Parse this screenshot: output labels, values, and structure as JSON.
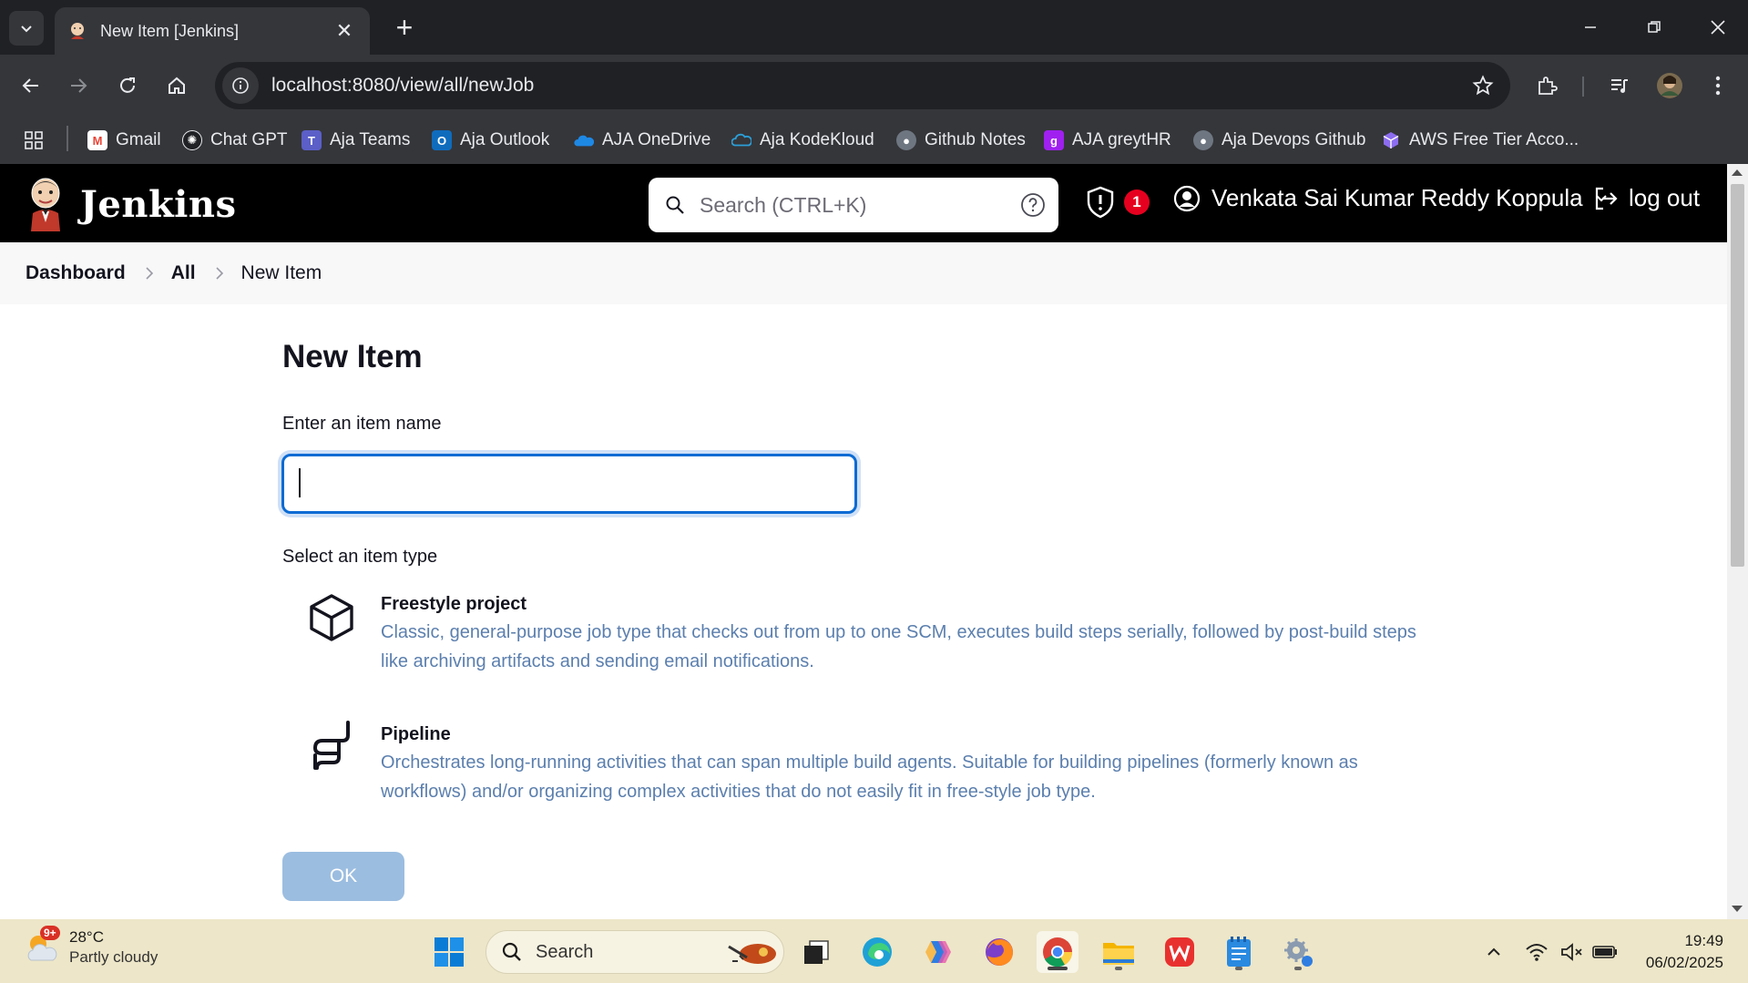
{
  "browser": {
    "tab_title": "New Item [Jenkins]",
    "url": "localhost:8080/view/all/newJob",
    "bookmarks": [
      {
        "label": "Gmail",
        "icon": "gmail-icon",
        "color": "#ea4335"
      },
      {
        "label": "Chat GPT",
        "icon": "chatgpt-icon",
        "color": "#202124"
      },
      {
        "label": "Aja Teams",
        "icon": "teams-icon",
        "color": "#5b5fc7"
      },
      {
        "label": "Aja Outlook",
        "icon": "outlook-icon",
        "color": "#0f6cbd"
      },
      {
        "label": "AJA OneDrive",
        "icon": "onedrive-icon",
        "color": "#1e88e5"
      },
      {
        "label": "Aja KodeKloud",
        "icon": "kodekloud-icon",
        "color": "#2b9fd8"
      },
      {
        "label": "Github Notes",
        "icon": "github-icon",
        "color": "#6e7681"
      },
      {
        "label": "AJA greytHR",
        "icon": "greythr-icon",
        "color": "#a020f0"
      },
      {
        "label": "Aja Devops Github",
        "icon": "github-icon",
        "color": "#6e7681"
      },
      {
        "label": "AWS Free Tier Acco...",
        "icon": "aws-icon",
        "color": "#8c6cf0"
      }
    ]
  },
  "header": {
    "logo_text": "Jenkins",
    "search_placeholder": "Search (CTRL+K)",
    "security_count": "1",
    "user_name": "Venkata Sai Kumar Reddy Koppula",
    "logout_label": "log out"
  },
  "breadcrumb": {
    "items": [
      "Dashboard",
      "All",
      "New Item"
    ]
  },
  "main": {
    "title": "New Item",
    "name_label": "Enter an item name",
    "name_value": "",
    "type_label": "Select an item type",
    "item_types": [
      {
        "title": "Freestyle project",
        "description": "Classic, general-purpose job type that checks out from up to one SCM, executes build steps serially, followed by post-build steps like archiving artifacts and sending email notifications.",
        "icon": "cube-icon"
      },
      {
        "title": "Pipeline",
        "description": "Orchestrates long-running activities that can span multiple build agents. Suitable for building pipelines (formerly known as workflows) and/or organizing complex activities that do not easily fit in free-style job type.",
        "icon": "pipeline-icon"
      }
    ],
    "ok_label": "OK"
  },
  "taskbar": {
    "weather_temp": "28°C",
    "weather_condition": "Partly cloudy",
    "weather_badge": "9+",
    "search_label": "Search",
    "time": "19:49",
    "date": "06/02/2025"
  },
  "colors": {
    "jenkins_header": "#000000",
    "accent_blue": "#0b6bd3",
    "description_text": "#5b7fae",
    "ok_button_disabled": "#9bbde0",
    "badge_red": "#e6001f"
  }
}
